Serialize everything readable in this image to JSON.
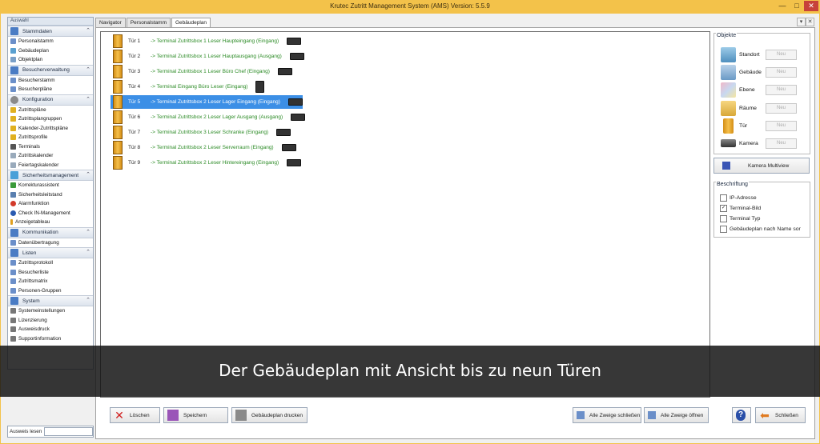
{
  "window": {
    "title": "Krutec Zutritt Management System (AMS)  Version: 5.5.9",
    "minimize": "—",
    "maximize": "□",
    "close": "✕"
  },
  "sidebar": {
    "header": "Auswahl",
    "groups": [
      {
        "label": "Stammdaten",
        "items": [
          "Personalstamm",
          "Gebäudeplan",
          "Objektplan"
        ]
      },
      {
        "label": "Besucherverwaltung",
        "items": [
          "Besucherstamm",
          "Besucherpläne"
        ]
      },
      {
        "label": "Konfiguration",
        "items": [
          "Zutrittspläne",
          "Zutrittsplangruppen",
          "Kalender-Zutrittspläne",
          "Zutrittsprofile",
          "Terminals",
          "Zutrittskalender",
          "Feiertagskalender"
        ]
      },
      {
        "label": "Sicherheitsmanagement",
        "items": [
          "Korrekturassistent",
          "Sicherheitsleitstand",
          "Alarmfunktion",
          "Check IN-Management",
          "Anzeigetableau"
        ]
      },
      {
        "label": "Kommunikation",
        "items": [
          "Datenübertragung"
        ]
      },
      {
        "label": "Listen",
        "items": [
          "Zutrittsprotokoll",
          "Besucherliste",
          "Zutrittsmatrix",
          "Personen-Gruppen"
        ]
      },
      {
        "label": "System",
        "items": [
          "Systemeinstellungen",
          "Lizenzierung",
          "Ausweisdruck",
          "Supportinformation"
        ]
      }
    ],
    "search_label": "Ausweis lesen"
  },
  "tabs": [
    "Navigator",
    "Personalstamm",
    "Gebäudeplan"
  ],
  "active_tab": 2,
  "doors": [
    {
      "label": "Tür 1",
      "terminal": "-> Terminal Zutrittsbox 1  Leser Haupteingang (Eingang)",
      "device": "reader"
    },
    {
      "label": "Tür 2",
      "terminal": "-> Terminal Zutrittsbox 1  Leser Hauptausgang (Ausgang)",
      "device": "reader"
    },
    {
      "label": "Tür 3",
      "terminal": "-> Terminal Zutrittsbox 1  Leser Büro Chef (Eingang)",
      "device": "reader"
    },
    {
      "label": "Tür 4",
      "terminal": "-> Terminal Eingang Büro  Leser  (Eingang)",
      "device": "wall"
    },
    {
      "label": "Tür 5",
      "terminal": "-> Terminal Zutrittsbox 2  Leser Lager Eingang (Eingang)",
      "device": "reader"
    },
    {
      "label": "Tür 6",
      "terminal": "-> Terminal Zutrittsbox 2  Leser Lager Ausgang (Ausgang)",
      "device": "reader"
    },
    {
      "label": "Tür 7",
      "terminal": "-> Terminal Zutrittsbox 3  Leser Schranke (Eingang)",
      "device": "reader"
    },
    {
      "label": "Tür 8",
      "terminal": "-> Terminal Zutrittsbox 2  Leser Serverraum (Eingang)",
      "device": "reader"
    },
    {
      "label": "Tür 9",
      "terminal": "-> Terminal Zutrittsbox 2  Leser Hintereingang (Eingang)",
      "device": "reader"
    }
  ],
  "selected_door": 4,
  "objekte": {
    "title": "Objekte",
    "new_label": "Neu",
    "rows": [
      "Standort",
      "Gebäude",
      "Ebene",
      "Räume",
      "Tür",
      "Kamera"
    ]
  },
  "multiview_label": "Kamera Multiview",
  "beschriftung": {
    "title": "Beschriftung",
    "options": [
      {
        "label": "IP-Adresse",
        "checked": false
      },
      {
        "label": "Terminal-Bild",
        "checked": true
      },
      {
        "label": "Terminal Typ",
        "checked": false
      },
      {
        "label": "Gebäudeplan nach Name sor",
        "checked": false
      }
    ]
  },
  "buttons": {
    "loeschen": "Löschen",
    "speichern": "Speichern",
    "drucken": "Gebäudeplan drucken",
    "zweige_schliessen": "Alle Zweige schließen",
    "zweige_oeffnen": "Alle Zweige öffnen",
    "help": "?",
    "schliessen": "Schließen"
  },
  "caption": "Der Gebäudeplan mit Ansicht bis zu neun Türen",
  "colors": {
    "titlebar": "#f3c24a",
    "selection": "#3c8fe6",
    "terminal_text": "#2a8a24"
  }
}
